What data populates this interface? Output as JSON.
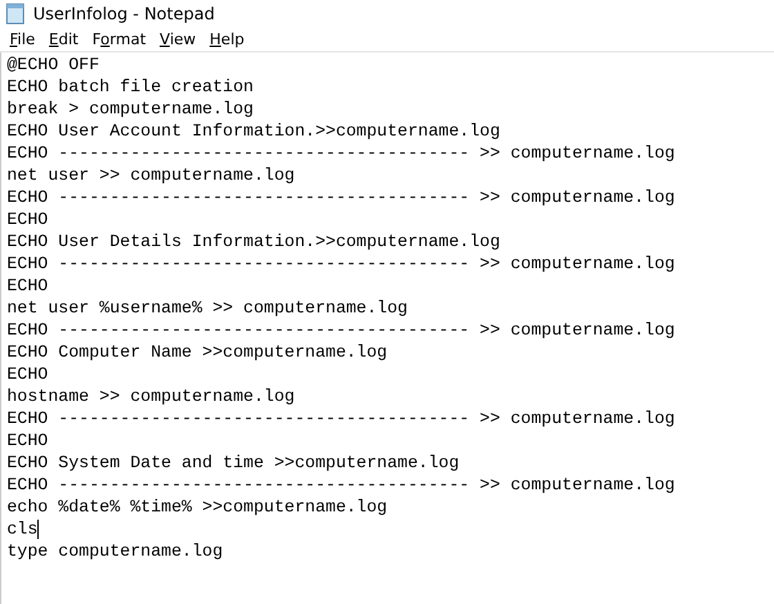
{
  "window": {
    "title": "UserInfolog - Notepad"
  },
  "menu": [
    {
      "access_key": "F",
      "after": "ile"
    },
    {
      "access_key": "E",
      "after": "dit"
    },
    {
      "before": "F",
      "access_key": "o",
      "after": "rmat"
    },
    {
      "access_key": "V",
      "after": "iew"
    },
    {
      "access_key": "H",
      "after": "elp"
    }
  ],
  "editor": {
    "lines": [
      {
        "text": "@ECHO OFF",
        "caret": false
      },
      {
        "text": "ECHO batch file creation",
        "caret": false
      },
      {
        "text": "break > computername.log",
        "caret": false
      },
      {
        "text": "ECHO User Account Information.>>computername.log",
        "caret": false
      },
      {
        "text": "ECHO ---------------------------------------- >> computername.log",
        "caret": false
      },
      {
        "text": "net user >> computername.log",
        "caret": false
      },
      {
        "text": "ECHO ---------------------------------------- >> computername.log",
        "caret": false
      },
      {
        "text": "ECHO",
        "caret": false
      },
      {
        "text": "ECHO User Details Information.>>computername.log",
        "caret": false
      },
      {
        "text": "ECHO ---------------------------------------- >> computername.log",
        "caret": false
      },
      {
        "text": "ECHO",
        "caret": false
      },
      {
        "text": "net user %username% >> computername.log",
        "caret": false
      },
      {
        "text": "ECHO ---------------------------------------- >> computername.log",
        "caret": false
      },
      {
        "text": "ECHO Computer Name >>computername.log",
        "caret": false
      },
      {
        "text": "ECHO",
        "caret": false
      },
      {
        "text": "hostname >> computername.log",
        "caret": false
      },
      {
        "text": "ECHO ---------------------------------------- >> computername.log",
        "caret": false
      },
      {
        "text": "ECHO",
        "caret": false
      },
      {
        "text": "ECHO System Date and time >>computername.log",
        "caret": false
      },
      {
        "text": "ECHO ---------------------------------------- >> computername.log",
        "caret": false
      },
      {
        "text": "echo %date% %time% >>computername.log",
        "caret": false
      },
      {
        "text": "cls",
        "caret": true
      },
      {
        "text": "type computername.log",
        "caret": false
      }
    ]
  }
}
